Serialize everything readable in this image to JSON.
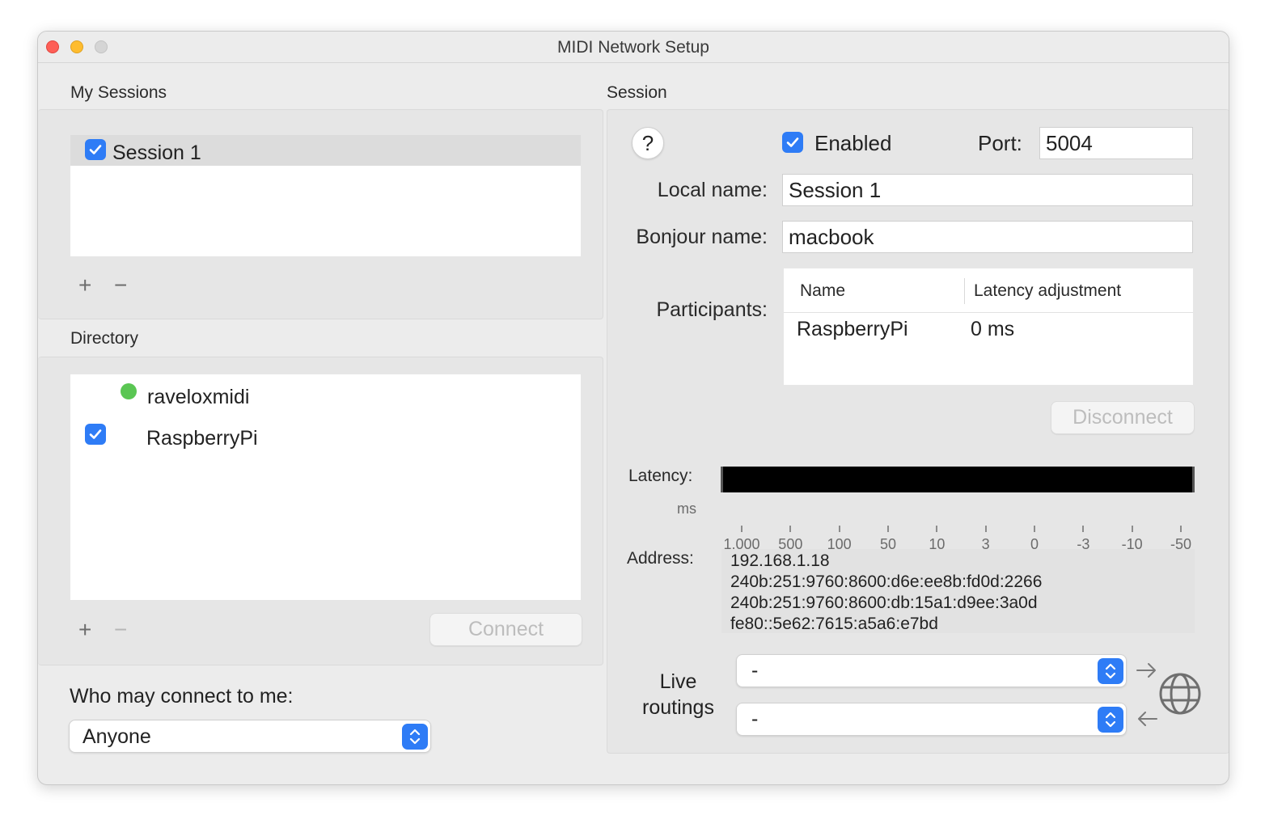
{
  "window": {
    "title": "MIDI Network Setup"
  },
  "my_sessions": {
    "label": "My Sessions",
    "items": [
      {
        "label": "Session 1",
        "checked": true
      }
    ],
    "add_label": "+",
    "remove_label": "−"
  },
  "directory": {
    "label": "Directory",
    "items": [
      {
        "label": "raveloxmidi",
        "status": "online-green-dot"
      },
      {
        "label": "RaspberryPi",
        "checked": true
      }
    ],
    "add_label": "+",
    "remove_label": "−",
    "connect_label": "Connect"
  },
  "who_may_connect": {
    "label": "Who may connect to me:",
    "selected": "Anyone"
  },
  "session": {
    "label": "Session",
    "help_label": "?",
    "enabled_label": "Enabled",
    "enabled": true,
    "port_label": "Port:",
    "port_value": "5004",
    "local_name_label": "Local name:",
    "local_name_value": "Session 1",
    "bonjour_name_label": "Bonjour name:",
    "bonjour_name_value": "macbook",
    "participants_label": "Participants:",
    "participants": {
      "columns": [
        "Name",
        "Latency adjustment"
      ],
      "rows": [
        {
          "name": "RaspberryPi",
          "latency": "0 ms"
        }
      ]
    },
    "disconnect_label": "Disconnect",
    "latency_label": "Latency:",
    "latency_unit": "ms",
    "latency_scale": [
      "1,000",
      "500",
      "100",
      "50",
      "10",
      "3",
      "0",
      "-3",
      "-10",
      "-50"
    ],
    "address_label": "Address:",
    "addresses": [
      "192.168.1.18",
      "240b:251:9760:8600:d6e:ee8b:fd0d:2266",
      "240b:251:9760:8600:db:15a1:d9ee:3a0d",
      "fe80::5e62:7615:a5a6:e7bd"
    ],
    "live_routings_label_1": "Live",
    "live_routings_label_2": "routings",
    "routing_out_value": "-",
    "routing_in_value": "-"
  },
  "colors": {
    "accent": "#2e7cf6",
    "online_dot": "#5ac653",
    "window_bg": "#ececec"
  }
}
